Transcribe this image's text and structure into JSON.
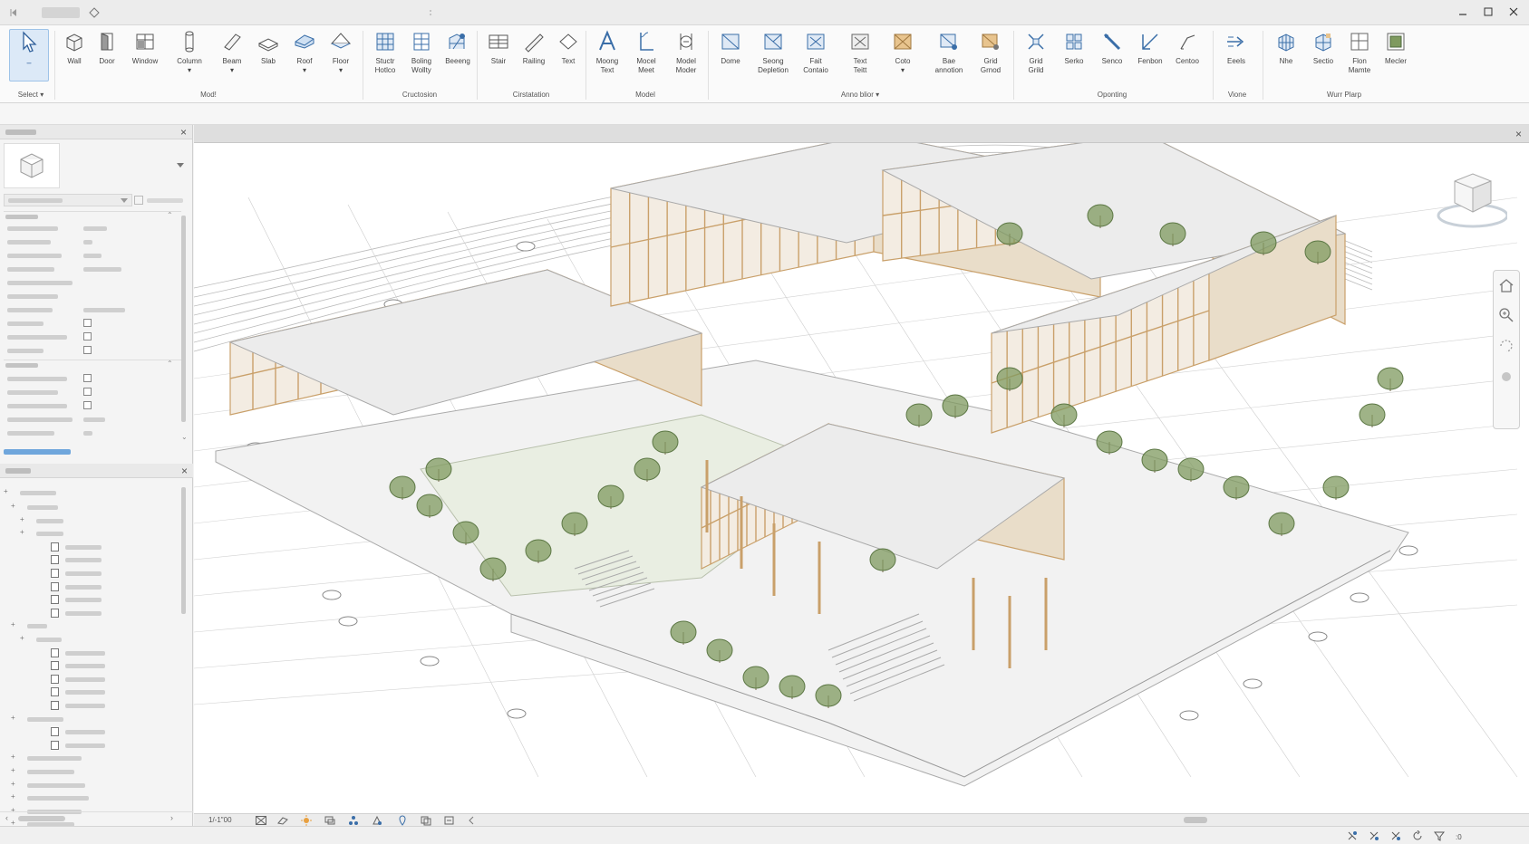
{
  "ribbon": {
    "tools": [
      {
        "id": "modify",
        "label": "̶̶̶̶"
      },
      {
        "label": "Wall"
      },
      {
        "label": "Door"
      },
      {
        "label": "Window"
      },
      {
        "label": "Column"
      },
      {
        "label": "Beam"
      },
      {
        "label": "Slab"
      },
      {
        "label": "Roof"
      },
      {
        "label": "Floor"
      },
      {
        "label": "Stuctr\nHotlco"
      },
      {
        "label": "Boling\nWollty"
      },
      {
        "label": "Beeeng"
      },
      {
        "label": "Stair"
      },
      {
        "label": "Railing"
      },
      {
        "label": "Text"
      },
      {
        "label": "Moong\nText"
      },
      {
        "label": "Mocel\nMeet"
      },
      {
        "label": "Model\nModer"
      },
      {
        "label": "Dome"
      },
      {
        "label": "Seong\nDepletion"
      },
      {
        "label": "Fait\nContaio"
      },
      {
        "label": "Text\nTeitt"
      },
      {
        "label": "Coto"
      },
      {
        "label": "Bae\nannotion"
      },
      {
        "label": "Grid\nGrnod"
      },
      {
        "label": "Grid\nGrild"
      },
      {
        "label": "Serko"
      },
      {
        "label": "Senco"
      },
      {
        "label": "Fenbon"
      },
      {
        "label": "Centoo"
      },
      {
        "label": "Eeels"
      },
      {
        "label": "Nhe"
      },
      {
        "label": "Sectio"
      },
      {
        "label": "Flon\nMamte"
      },
      {
        "label": "Mecler"
      }
    ],
    "panels": {
      "select": "Select",
      "model": "Mod!",
      "cructosion": "Cructosion",
      "cirtatation": "Cirstatation",
      "model2": "Model",
      "annotation": "Anno blior",
      "opening": "Oponting",
      "vione": "Vione",
      "wurr_plarp": "Wurr Plarp"
    }
  },
  "status": {
    "scale": "1/-1\"00"
  },
  "colors": {
    "accent": "#2f7fd6",
    "timber": "#c9a06a",
    "roof": "#ececec",
    "tree": "#7f9a5f"
  }
}
